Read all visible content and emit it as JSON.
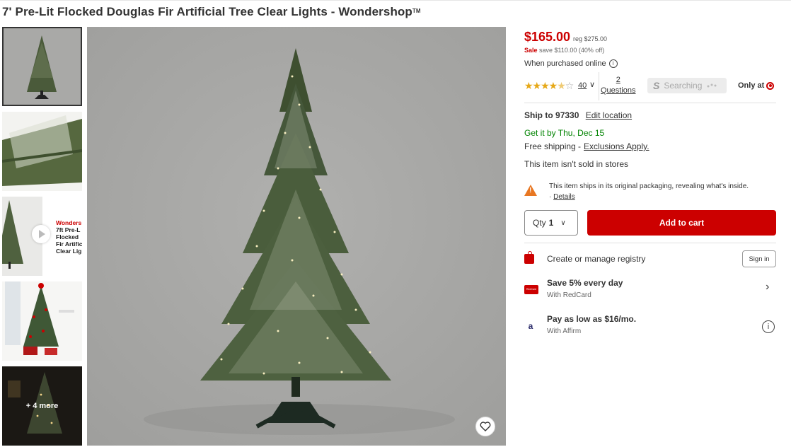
{
  "product": {
    "title": "7' Pre-Lit Flocked Douglas Fir Artificial Tree Clear Lights - Wondershop",
    "trademark": "TM"
  },
  "thumbnails": {
    "video_brand": "Wonders",
    "video_line1": "7ft Pre-L",
    "video_line2": "Flocked",
    "video_line3": "Fir Artific",
    "video_line4": "Clear Lig",
    "more_label": "+ 4 more"
  },
  "pricing": {
    "price": "$165.00",
    "reg": "reg $275.00",
    "sale_label": "Sale",
    "save_text": "save $110.00 (40% off)",
    "online_note": "When purchased online",
    "info_glyph": "i"
  },
  "ratings": {
    "stars": 4.5,
    "star_full": "★★★★",
    "star_half": "★",
    "star_empty": "☆",
    "count": "40",
    "chevron": "∨",
    "questions_count": "2",
    "questions_label": "Questions",
    "searching_s": "S",
    "searching_label": "Searching",
    "only_at": "Only at"
  },
  "shipping": {
    "ship_to_label": "Ship to",
    "zip": "97330",
    "edit_location": "Edit location",
    "get_it": "Get it by Thu, Dec 15",
    "free_shipping": "Free shipping -",
    "exclusions": "Exclusions Apply.",
    "not_in_stores": "This item isn't sold in stores"
  },
  "notice": {
    "text": "This item ships in its original packaging, revealing what's inside.",
    "separator": "·",
    "details": "Details"
  },
  "cart": {
    "qty_label": "Qty",
    "qty_value": "1",
    "qty_arrow": "∨",
    "add_to_cart": "Add to cart"
  },
  "registry": {
    "label": "Create or manage registry",
    "sign_in": "Sign in"
  },
  "redcard": {
    "title": "Save 5% every day",
    "subtitle": "With RedCard",
    "card_text": "RedCard",
    "chevron": "›"
  },
  "affirm": {
    "title": "Pay as low as $16/mo.",
    "subtitle": "With Affirm",
    "logo": "a",
    "info_glyph": "i"
  },
  "colors": {
    "target_red": "#cc0000",
    "sale_green": "#008300",
    "warning_orange": "#e87722"
  }
}
